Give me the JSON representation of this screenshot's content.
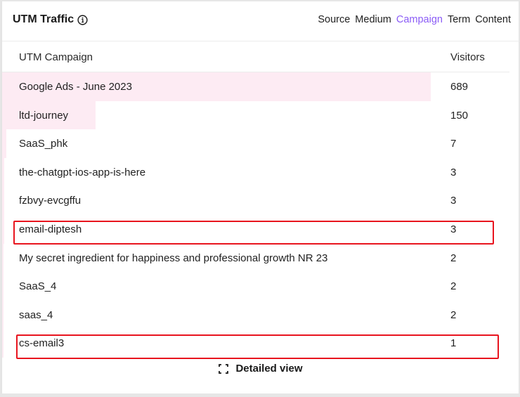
{
  "widget": {
    "title": "UTM Traffic",
    "info_icon": "info-circle-icon",
    "tabs": [
      {
        "label": "Source",
        "active": false
      },
      {
        "label": "Medium",
        "active": false
      },
      {
        "label": "Campaign",
        "active": true
      },
      {
        "label": "Term",
        "active": false
      },
      {
        "label": "Content",
        "active": false
      }
    ],
    "accent_color": "#8b5cf6",
    "bar_color": "#fdebf3",
    "highlight_color": "#e8141e"
  },
  "table": {
    "columns": {
      "name": "UTM Campaign",
      "value": "Visitors"
    },
    "rows": [
      {
        "name": "Google Ads - June 2023",
        "visitors": "689",
        "value": 689,
        "highlighted": false
      },
      {
        "name": "ltd-journey",
        "visitors": "150",
        "value": 150,
        "highlighted": false
      },
      {
        "name": "SaaS_phk",
        "visitors": "7",
        "value": 7,
        "highlighted": false
      },
      {
        "name": "the-chatgpt-ios-app-is-here",
        "visitors": "3",
        "value": 3,
        "highlighted": false
      },
      {
        "name": "fzbvy-evcgffu",
        "visitors": "3",
        "value": 3,
        "highlighted": false
      },
      {
        "name": "email-diptesh",
        "visitors": "3",
        "value": 3,
        "highlighted": true
      },
      {
        "name": "My secret ingredient for happiness and professional growth NR 23",
        "visitors": "2",
        "value": 2,
        "highlighted": false
      },
      {
        "name": "SaaS_4",
        "visitors": "2",
        "value": 2,
        "highlighted": false
      },
      {
        "name": "saas_4",
        "visitors": "2",
        "value": 2,
        "highlighted": false
      },
      {
        "name": "cs-email3",
        "visitors": "1",
        "value": 1,
        "highlighted": true
      }
    ]
  },
  "footer": {
    "detailed_view_label": "Detailed view",
    "icon": "expand-icon"
  }
}
